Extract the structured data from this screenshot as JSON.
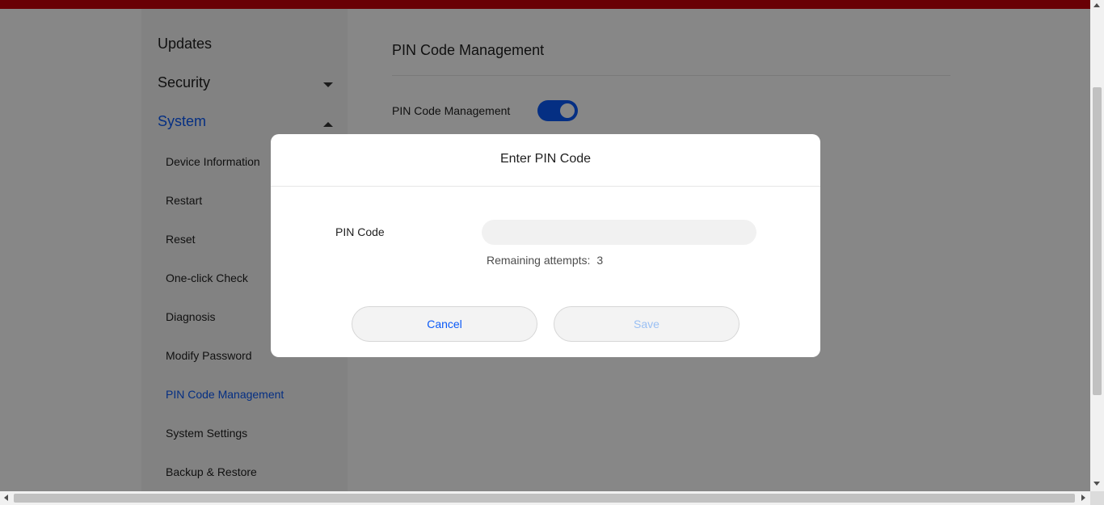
{
  "colors": {
    "brand": "#c7000b",
    "accent": "#0a59f7",
    "disabled": "#9bc0f3"
  },
  "sidebar": {
    "groups": [
      {
        "label": "Updates"
      },
      {
        "label": "Security",
        "expanded": false
      },
      {
        "label": "System",
        "expanded": true
      }
    ],
    "items": [
      {
        "label": "Device Information"
      },
      {
        "label": "Restart"
      },
      {
        "label": "Reset"
      },
      {
        "label": "One-click Check"
      },
      {
        "label": "Diagnosis"
      },
      {
        "label": "Modify Password"
      },
      {
        "label": "PIN Code Management"
      },
      {
        "label": "System Settings"
      },
      {
        "label": "Backup & Restore"
      }
    ],
    "active_item": "PIN Code Management"
  },
  "main": {
    "title": "PIN Code Management",
    "toggle_label": "PIN Code Management",
    "toggle_state": "on"
  },
  "modal": {
    "title": "Enter PIN Code",
    "pin_label": "PIN Code",
    "pin_value": "",
    "remaining_label": "Remaining attempts:",
    "remaining_count": "3",
    "cancel_label": "Cancel",
    "save_label": "Save"
  }
}
